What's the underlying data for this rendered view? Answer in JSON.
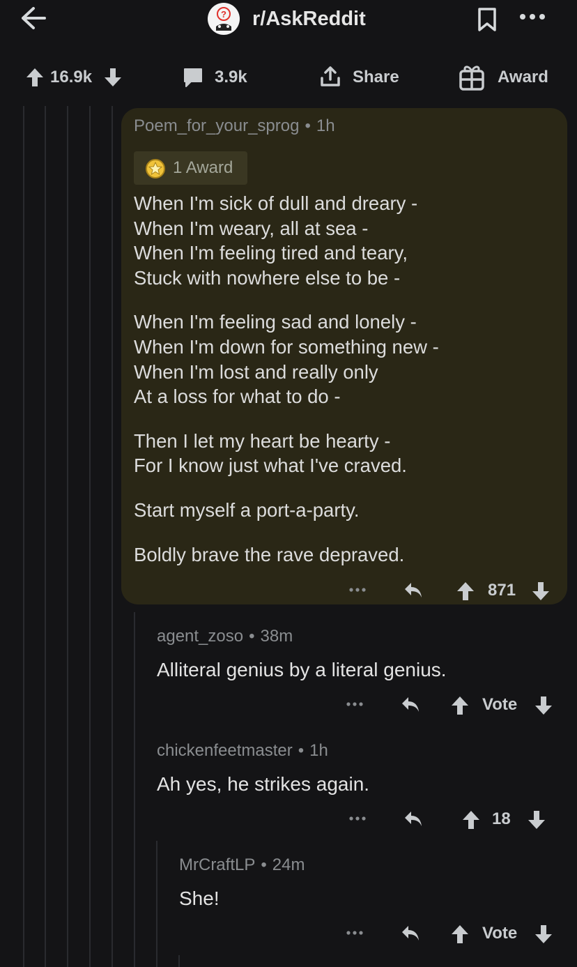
{
  "header": {
    "subreddit": "r/AskReddit"
  },
  "post_actions": {
    "score": "16.9k",
    "comments": "3.9k",
    "share_label": "Share",
    "award_label": "Award"
  },
  "comments": [
    {
      "author": "Poem_for_your_sprog",
      "age": "1h",
      "award_label": "1 Award",
      "stanzas": [
        [
          "When I'm sick of dull and dreary -",
          "When I'm weary, all at sea -",
          "When I'm feeling tired and teary,",
          "Stuck with nowhere else to be -"
        ],
        [
          "When I'm feeling sad and lonely -",
          "When I'm down for something new -",
          "When I'm lost and really only",
          "At a loss for what to do -"
        ],
        [
          "Then I let my heart be hearty -",
          "For I know just what I've craved."
        ],
        [
          "Start myself a port-a-party."
        ],
        [
          "Boldly brave the rave depraved."
        ]
      ],
      "score": "871",
      "highlighted": true,
      "highlight_color": "#2a2716"
    },
    {
      "author": "agent_zoso",
      "age": "38m",
      "text": "Alliteral genius by a literal genius.",
      "score": "Vote"
    },
    {
      "author": "chickenfeetmaster",
      "age": "1h",
      "text": "Ah yes, he strikes again.",
      "score": "18"
    },
    {
      "author": "MrCraftLP",
      "age": "24m",
      "text": "She!",
      "score": "Vote"
    }
  ],
  "icons": [
    "back-arrow-icon",
    "subreddit-avatar-icon",
    "bookmark-icon",
    "more-icon",
    "upvote-icon",
    "downvote-icon",
    "comment-icon",
    "share-icon",
    "gift-icon",
    "award-star-icon",
    "reply-icon"
  ],
  "colors": {
    "background": "#141416",
    "highlight": "#2a2716",
    "text": "#dcdcdc",
    "meta": "#8a8d90"
  }
}
